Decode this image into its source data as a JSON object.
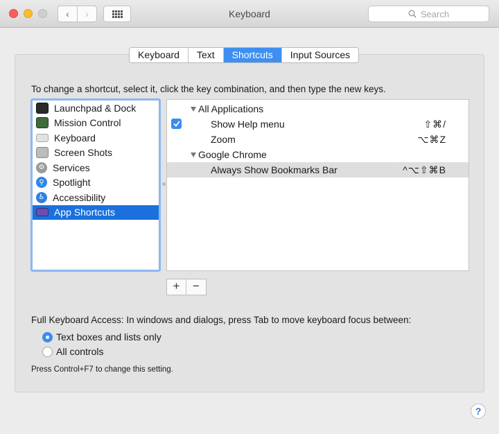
{
  "window": {
    "title": "Keyboard",
    "search_placeholder": "Search"
  },
  "nav": {
    "back_glyph": "‹",
    "forward_glyph": "›"
  },
  "tabs": [
    {
      "label": "Keyboard",
      "active": false
    },
    {
      "label": "Text",
      "active": false
    },
    {
      "label": "Shortcuts",
      "active": true
    },
    {
      "label": "Input Sources",
      "active": false
    }
  ],
  "instruction": "To change a shortcut, select it, click the key combination, and then type the new keys.",
  "categories": [
    {
      "label": "Launchpad & Dock",
      "icon": "launchpad-dock-icon",
      "color": "#2b2b2b",
      "selected": false
    },
    {
      "label": "Mission Control",
      "icon": "mission-control-icon",
      "color": "#3f6b3b",
      "selected": false
    },
    {
      "label": "Keyboard",
      "icon": "keyboard-icon",
      "color": "#d8d8d8",
      "selected": false
    },
    {
      "label": "Screen Shots",
      "icon": "screen-shots-icon",
      "color": "#9a9a9a",
      "selected": false
    },
    {
      "label": "Services",
      "icon": "services-gear-icon",
      "color": "#8a8a8a",
      "selected": false
    },
    {
      "label": "Spotlight",
      "icon": "spotlight-icon",
      "color": "#2f86e8",
      "selected": false
    },
    {
      "label": "Accessibility",
      "icon": "accessibility-icon",
      "color": "#2f7fe0",
      "selected": false
    },
    {
      "label": "App Shortcuts",
      "icon": "app-shortcuts-icon",
      "color": "#6a4fb3",
      "selected": true
    }
  ],
  "shortcuts": {
    "groups": [
      {
        "name": "All Applications",
        "items": [
          {
            "label": "Show Help menu",
            "keys": "⇧⌘/",
            "checked": true
          },
          {
            "label": "Zoom",
            "keys": "⌥⌘Z",
            "checked": false
          }
        ]
      },
      {
        "name": "Google Chrome",
        "items": [
          {
            "label": "Always Show Bookmarks Bar",
            "keys": "^⌥⇧⌘B",
            "checked": false,
            "highlighted": true
          }
        ]
      }
    ]
  },
  "buttons": {
    "add": "+",
    "remove": "−"
  },
  "full_keyboard_access": {
    "label": "Full Keyboard Access: In windows and dialogs, press Tab to move keyboard focus between:",
    "options": [
      {
        "label": "Text boxes and lists only",
        "selected": true
      },
      {
        "label": "All controls",
        "selected": false
      }
    ],
    "note": "Press Control+F7 to change this setting."
  },
  "help": "?"
}
